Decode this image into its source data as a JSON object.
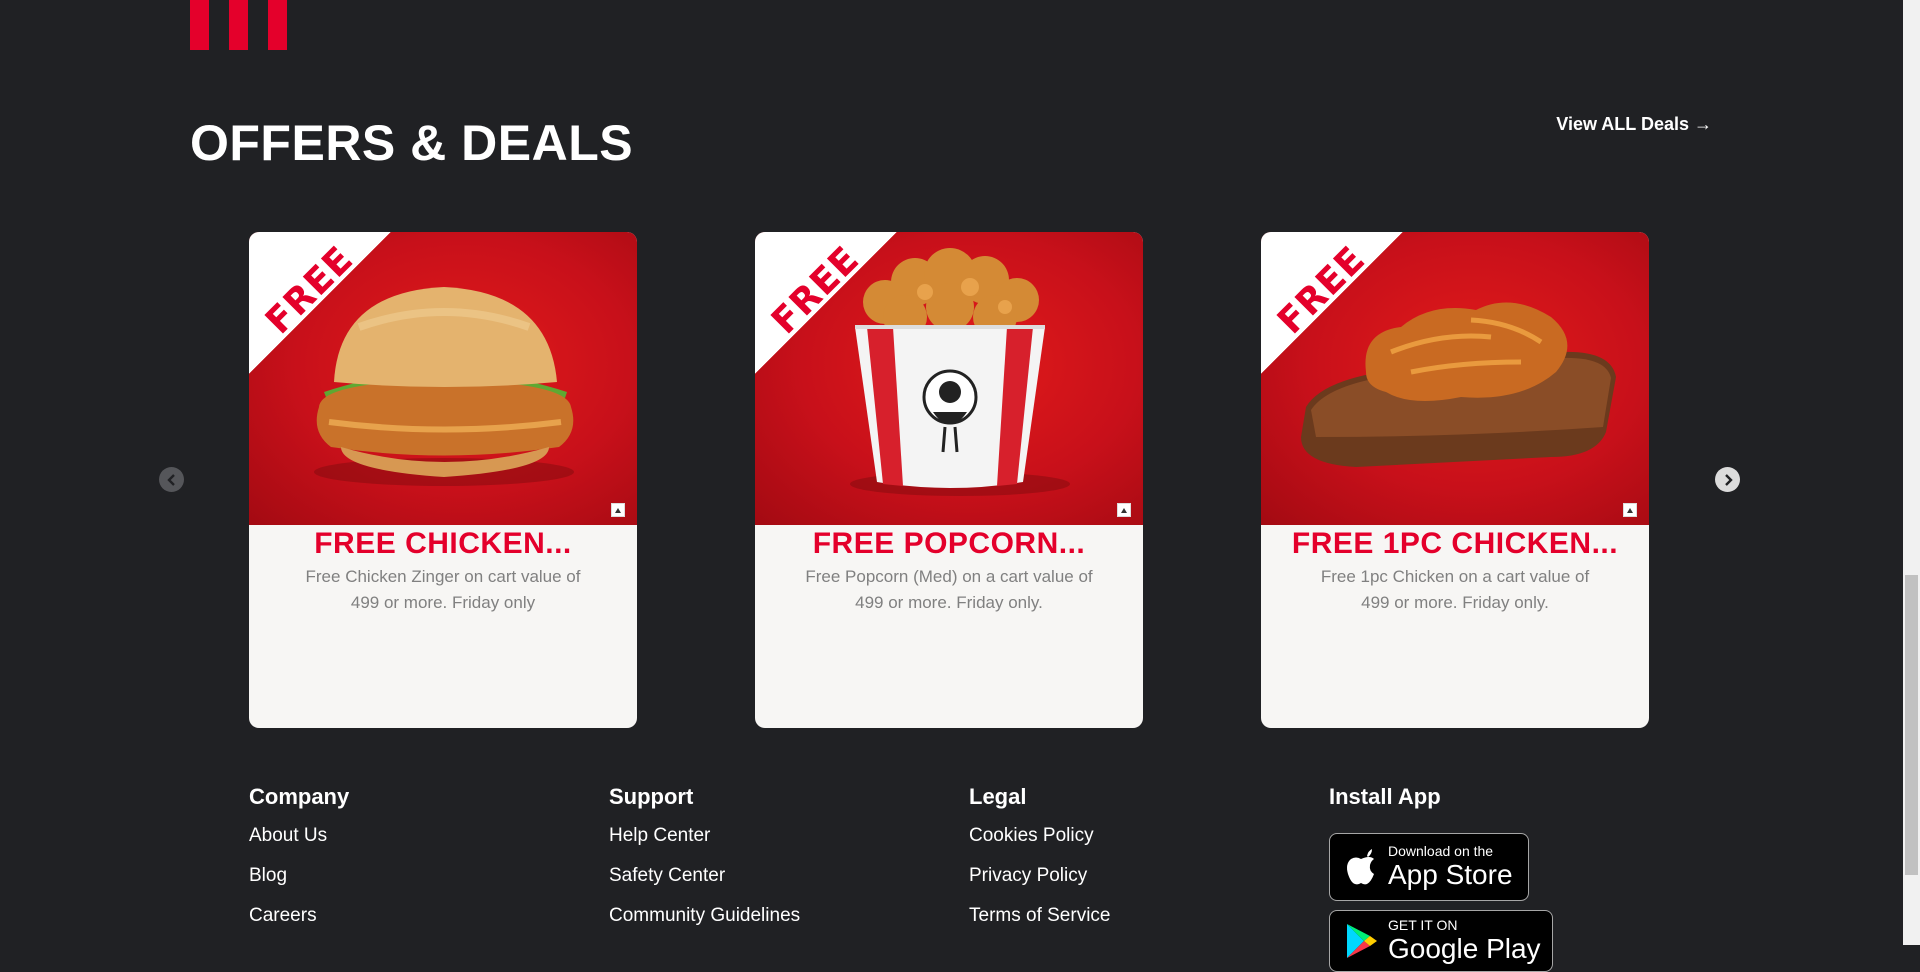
{
  "offers": {
    "title": "OFFERS & DEALS",
    "view_all": "View ALL Deals →",
    "cards": [
      {
        "badge": "FREE",
        "title": "FREE CHICKEN...",
        "description": "Free Chicken Zinger on cart value of 499 or more. Friday only",
        "image": "zinger-burger"
      },
      {
        "badge": "FREE",
        "title": "FREE POPCORN...",
        "description": "Free Popcorn (Med) on a cart value of 499 or more. Friday only.",
        "image": "popcorn-bucket"
      },
      {
        "badge": "FREE",
        "title": "FREE 1PC CHICKEN...",
        "description": "Free 1pc Chicken on a cart value of 499 or more. Friday only.",
        "image": "fried-chicken-piece"
      }
    ]
  },
  "footer": {
    "company": {
      "heading": "Company",
      "links": [
        "About Us",
        "Blog",
        "Careers"
      ]
    },
    "support": {
      "heading": "Support",
      "links": [
        "Help Center",
        "Safety Center",
        "Community Guidelines"
      ]
    },
    "legal": {
      "heading": "Legal",
      "links": [
        "Cookies Policy",
        "Privacy Policy",
        "Terms of Service"
      ]
    },
    "install": {
      "heading": "Install App",
      "app_store": {
        "small": "Download on the",
        "big": "App Store"
      },
      "google_play": {
        "small": "GET IT ON",
        "big": "Google Play"
      }
    }
  },
  "colors": {
    "background": "#202124",
    "brand_red": "#e4002b",
    "card_bg": "#f7f6f4"
  }
}
